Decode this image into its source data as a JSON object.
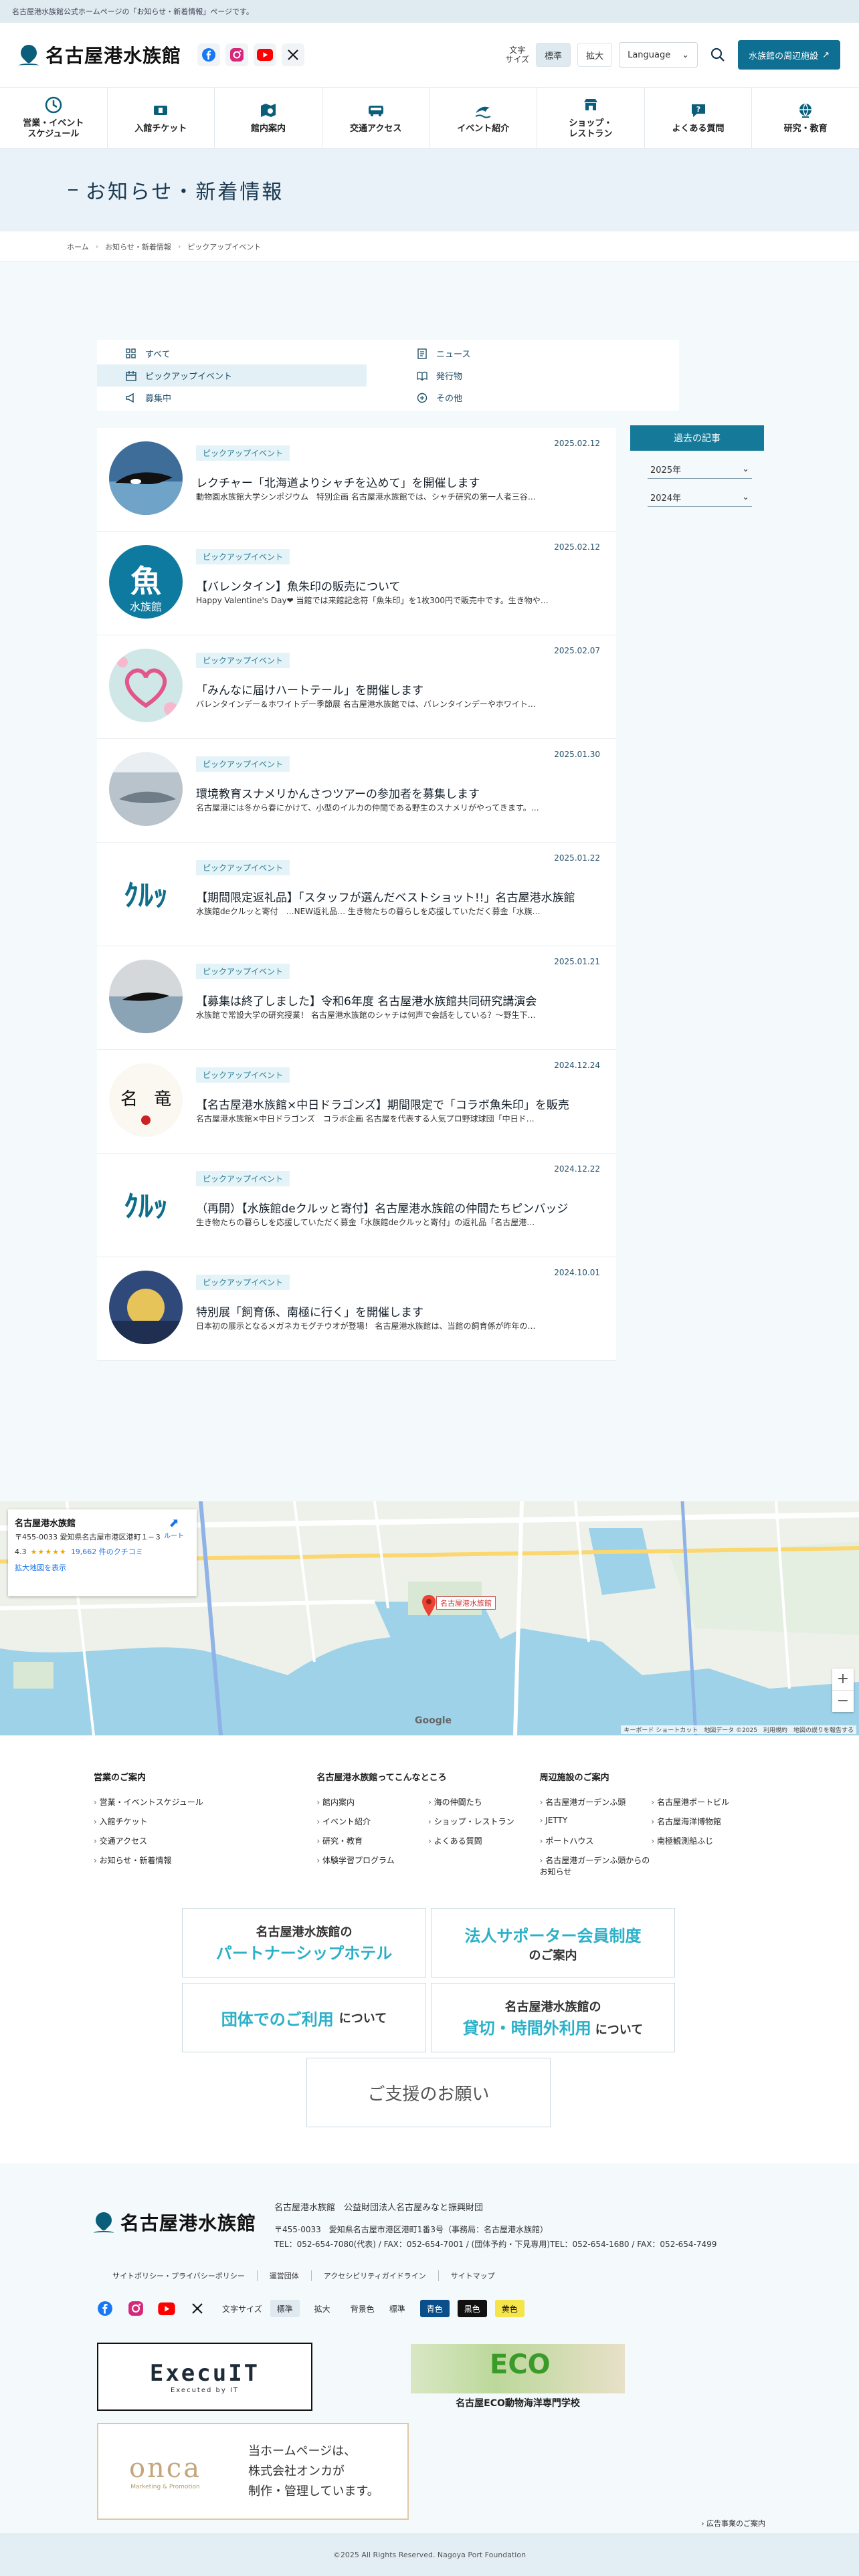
{
  "topbar": {
    "text": "名古屋港水族館公式ホームページの「お知らせ・新着情報」ページです。"
  },
  "header": {
    "logo": "名古屋港水族館",
    "font_size_label_1": "文字",
    "font_size_label_2": "サイズ",
    "font_standard": "標準",
    "font_large": "拡大",
    "language": "Language",
    "nearby": "水族館の周辺施設"
  },
  "gnav": [
    {
      "label": "営業・イベント\nスケジュール",
      "icon": "clock-icon"
    },
    {
      "label": "入館チケット",
      "icon": "ticket-icon"
    },
    {
      "label": "館内案内",
      "icon": "map-search-icon"
    },
    {
      "label": "交通アクセス",
      "icon": "bus-icon"
    },
    {
      "label": "イベント紹介",
      "icon": "dolphin-icon"
    },
    {
      "label": "ショップ・\nレストラン",
      "icon": "shop-icon"
    },
    {
      "label": "よくある質問",
      "icon": "question-icon"
    },
    {
      "label": "研究・教育",
      "icon": "globe-icon"
    }
  ],
  "hero": {
    "title": "お知らせ・新着情報"
  },
  "breadcrumb": [
    "ホーム",
    "お知らせ・新着情報",
    "ピックアップイベント"
  ],
  "filters": [
    {
      "label": "すべて",
      "icon": "grid-icon"
    },
    {
      "label": "ニュース",
      "icon": "document-icon"
    },
    {
      "label": "ピックアップイベント",
      "icon": "calendar-icon"
    },
    {
      "label": "発行物",
      "icon": "book-icon"
    },
    {
      "label": "募集中",
      "icon": "megaphone-icon"
    },
    {
      "label": "その他",
      "icon": "hand-icon"
    }
  ],
  "news": [
    {
      "tag": "ピックアップイベント",
      "date": "2025.02.12",
      "title": "レクチャー「北海道よりシャチを込めて」を開催します",
      "sub": "動物園水族館大学シンポジウム　特別企画 名古屋港水族館では、シャチ研究の第一人者三谷…",
      "thumb": "orca"
    },
    {
      "tag": "ピックアップイベント",
      "date": "2025.02.12",
      "title": "【バレンタイン】魚朱印の販売について",
      "sub": "Happy Valentine's Day❤ 当館では来館記念符「魚朱印」を1枚300円で販売中です。生き物や…",
      "thumb": "seal"
    },
    {
      "tag": "ピックアップイベント",
      "date": "2025.02.07",
      "title": "「みんなに届けハートテール」を開催します",
      "sub": "バレンタインデー＆ホワイトデー季節展 名古屋港水族館では、バレンタインデーやホワイト…",
      "thumb": "heart"
    },
    {
      "tag": "ピックアップイベント",
      "date": "2025.01.30",
      "title": "環境教育スナメリかんさつツアーの参加者を募集します",
      "sub": "名古屋港には冬から春にかけて、小型のイルカの仲間である野生のスナメリがやってきます。…",
      "thumb": "porpoise"
    },
    {
      "tag": "ピックアップイベント",
      "date": "2025.01.22",
      "title": "【期間限定返礼品】「スタッフが選んだベストショット!!」名古屋港水族館",
      "sub": "水族館deクルッと寄付　…NEW返礼品… 生き物たちの暮らしを応援していただく募金「水族…",
      "thumb": "crowd"
    },
    {
      "tag": "ピックアップイベント",
      "date": "2025.01.21",
      "title": "【募集は終了しました】令和6年度 名古屋港水族館共同研究講演会",
      "sub": "水族館で常設大学の研究授業！ 名古屋港水族館のシャチは何声で会話をしている？～野生下…",
      "thumb": "lecture"
    },
    {
      "tag": "ピックアップイベント",
      "date": "2024.12.24",
      "title": "【名古屋港水族館×中日ドラゴンズ】期間限定で「コラボ魚朱印」を販売",
      "sub": "名古屋港水族館×中日ドラゴンズ　コラボ企画 名古屋を代表する人気プロ野球球団「中日ド…",
      "thumb": "calligraphy"
    },
    {
      "tag": "ピックアップイベント",
      "date": "2024.12.22",
      "title": "（再開）【水族館deクルッと寄付】名古屋港水族館の仲間たちピンバッジ",
      "sub": "生き物たちの暮らしを応援していただく募金「水族館deクルッと寄付」の返礼品「名古屋港…",
      "thumb": "crowd"
    },
    {
      "tag": "ピックアップイベント",
      "date": "2024.10.01",
      "title": "特別展「飼育係、南極に行く」を開催します",
      "sub": "日本初の展示となるメガネカモグチウオが登場！ 名古屋港水族館は、当館の飼育係が昨年の…",
      "thumb": "antarctic"
    }
  ],
  "archive": {
    "title": "過去の記事",
    "years": [
      "2025年",
      "2024年"
    ]
  },
  "map": {
    "name": "名古屋港水族館",
    "address": "〒455-0033 愛知県名古屋市港区港町１−３",
    "rating": "4.3",
    "stars": "★★★★★",
    "reviews": "19,662 件のクチコミ",
    "enlarge": "拡大地図を表示",
    "route": "ルート",
    "pin_label": "名古屋港水族館",
    "footer": "キーボード ショートカット　地図データ ©2025　利用規約　地図の誤りを報告する",
    "google": "Google"
  },
  "footer_links": {
    "col1": {
      "title": "営業のご案内",
      "items": [
        "営業・イベントスケジュール",
        "入館チケット",
        "交通アクセス",
        "お知らせ・新着情報"
      ]
    },
    "col2": {
      "title": "名古屋港水族館ってこんなところ",
      "items": [
        "館内案内",
        "海の仲間たち",
        "イベント紹介",
        "ショップ・レストラン",
        "研究・教育",
        "よくある質問",
        "体験学習プログラム"
      ]
    },
    "col3": {
      "title": "周辺施設のご案内",
      "items": [
        "名古屋港ガーデンふ頭",
        "名古屋港ポートビル",
        "JETTY",
        "名古屋海洋博物館",
        "ポートハウス",
        "南極観測船ふじ",
        "名古屋港ガーデンふ頭からのお知らせ"
      ]
    }
  },
  "banners": {
    "b1": {
      "l1": "名古屋港水族館の",
      "l2": "パートナーシップホテル",
      "l3": ""
    },
    "b2": {
      "l1": "",
      "l2": "法人サポーター会員制度",
      "l3": "のご案内"
    },
    "b3": {
      "l1": "",
      "l2": "団体でのご利用",
      "l3": "について"
    },
    "b4": {
      "l1": "名古屋港水族館の",
      "l2": "貸切・時間外利用",
      "l3": "について"
    },
    "b5": {
      "l1": "",
      "l2": "ご支援のお願い",
      "l3": ""
    }
  },
  "info": {
    "org": "名古屋港水族館　公益財団法人名古屋みなと振興財団",
    "address": "〒455-0033　愛知県名古屋市港区港町1番3号（事務局：名古屋港水族館）",
    "tel": "TEL：052-654-7080(代表) / FAX：052-654-7001 / (団体予約・下見専用)TEL：052-654-1680 / FAX：052-654-7499",
    "links": [
      "サイトポリシー・プライバシーポリシー",
      "運営団体",
      "アクセシビリティガイドライン",
      "サイトマップ"
    ],
    "font_label": "文字サイズ",
    "font_standard": "標準",
    "font_large": "拡大",
    "bg_label": "背景色",
    "bg_standard": "標準",
    "bg_blue": "青色",
    "bg_black": "黒色",
    "bg_yellow": "黄色",
    "ad1_main": "ExecuIT",
    "ad1_sub": "Executed by IT",
    "ad2_eco": "ECO",
    "ad2_cap": "名古屋ECO動物海洋専門学校",
    "onca_mark": "onca",
    "onca_sub": "Marketing & Promotion",
    "onca_text_1": "当ホームページは、",
    "onca_text_2": "株式会社オンカが",
    "onca_text_3": "制作・管理しています。",
    "ad_info": "広告事業のご案内",
    "copyright": "©2025 All Rights Reserved. Nagoya Port Foundation"
  },
  "colors": {
    "accent": "#0e6f93",
    "tag_bg": "#e4f3f7",
    "archive_head": "#157a9a",
    "banner_text": "#2ab0c8"
  }
}
